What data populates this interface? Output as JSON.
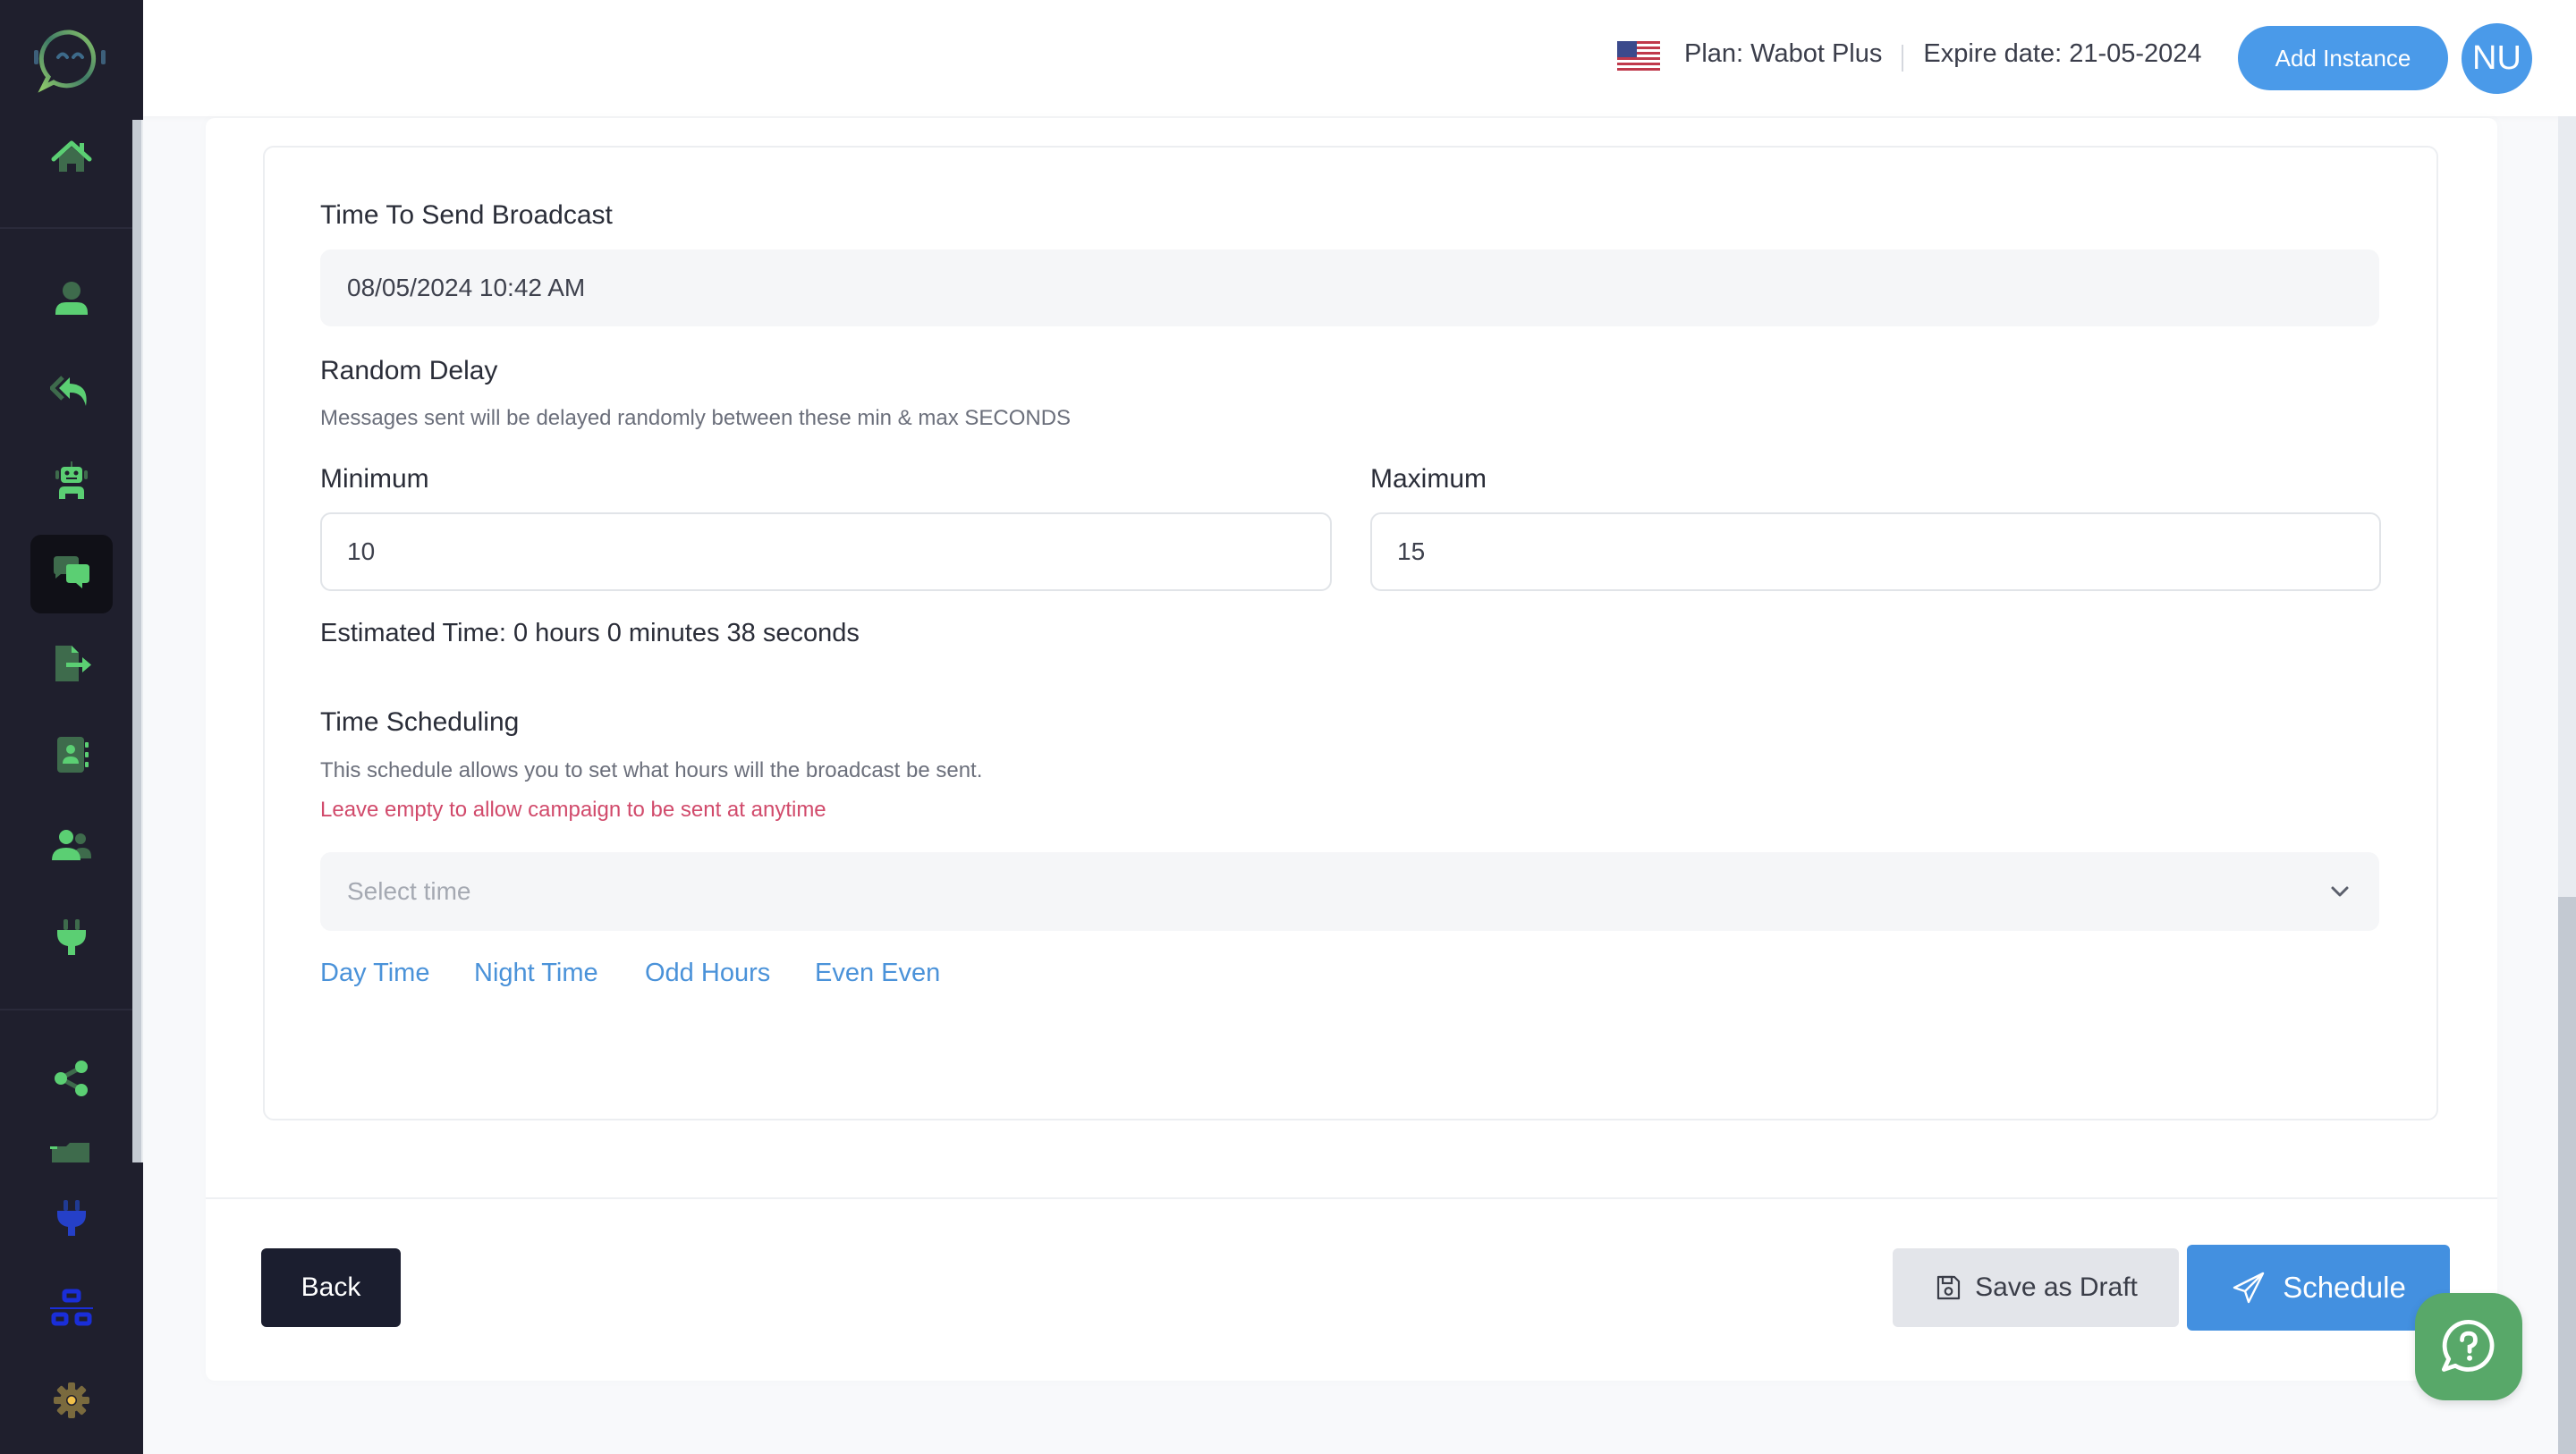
{
  "sidebar": {
    "logo": "chat-bot-logo",
    "items": [
      {
        "name": "home",
        "icon": "home-icon",
        "active": false
      },
      {
        "name": "contacts-user",
        "icon": "user-icon",
        "active": false
      },
      {
        "name": "auto-reply",
        "icon": "reply-all-icon",
        "active": false
      },
      {
        "name": "chatbot",
        "icon": "robot-icon",
        "active": false
      },
      {
        "name": "broadcast",
        "icon": "chat-bubbles-icon",
        "active": true
      },
      {
        "name": "export",
        "icon": "file-export-icon",
        "active": false
      },
      {
        "name": "phonebook",
        "icon": "address-book-icon",
        "active": false
      },
      {
        "name": "groups",
        "icon": "users-icon",
        "active": false
      },
      {
        "name": "integrations",
        "icon": "plug-icon",
        "active": false
      },
      {
        "name": "share",
        "icon": "share-icon",
        "active": false
      },
      {
        "name": "folder",
        "icon": "folder-icon",
        "active": false
      },
      {
        "name": "plugin",
        "icon": "plug-blue-icon",
        "active": false
      },
      {
        "name": "network",
        "icon": "sitemap-icon",
        "active": false
      },
      {
        "name": "settings",
        "icon": "gear-icon",
        "active": false
      }
    ]
  },
  "header": {
    "flag": "us-flag-icon",
    "plan": "Plan: Wabot Plus",
    "expire": "Expire date: 21-05-2024",
    "add_instance_label": "Add Instance",
    "avatar_initials": "NU"
  },
  "form": {
    "send_time": {
      "label": "Time To Send Broadcast",
      "value": "08/05/2024 10:42 AM"
    },
    "random_delay": {
      "label": "Random Delay",
      "help": "Messages sent will be delayed randomly between these min & max SECONDS",
      "min_label": "Minimum",
      "min_value": "10",
      "max_label": "Maximum",
      "max_value": "15",
      "estimate": "Estimated Time: 0 hours 0 minutes 38 seconds"
    },
    "scheduling": {
      "label": "Time Scheduling",
      "help": "This schedule allows you to set what hours will the broadcast be sent.",
      "warning": "Leave empty to allow campaign to be sent at anytime",
      "select_placeholder": "Select time",
      "quick_options": [
        "Day Time",
        "Night Time",
        "Odd Hours",
        "Even Even"
      ]
    }
  },
  "actions": {
    "back_label": "Back",
    "draft_label": "Save as Draft",
    "schedule_label": "Schedule"
  },
  "colors": {
    "sidebar_bg": "#1f1f2d",
    "icon_green": "#5bcf73",
    "icon_green_dark": "#3e6b4c",
    "primary_blue": "#4390e0",
    "warning_red": "#d14a6b",
    "help_green": "#58a869"
  }
}
